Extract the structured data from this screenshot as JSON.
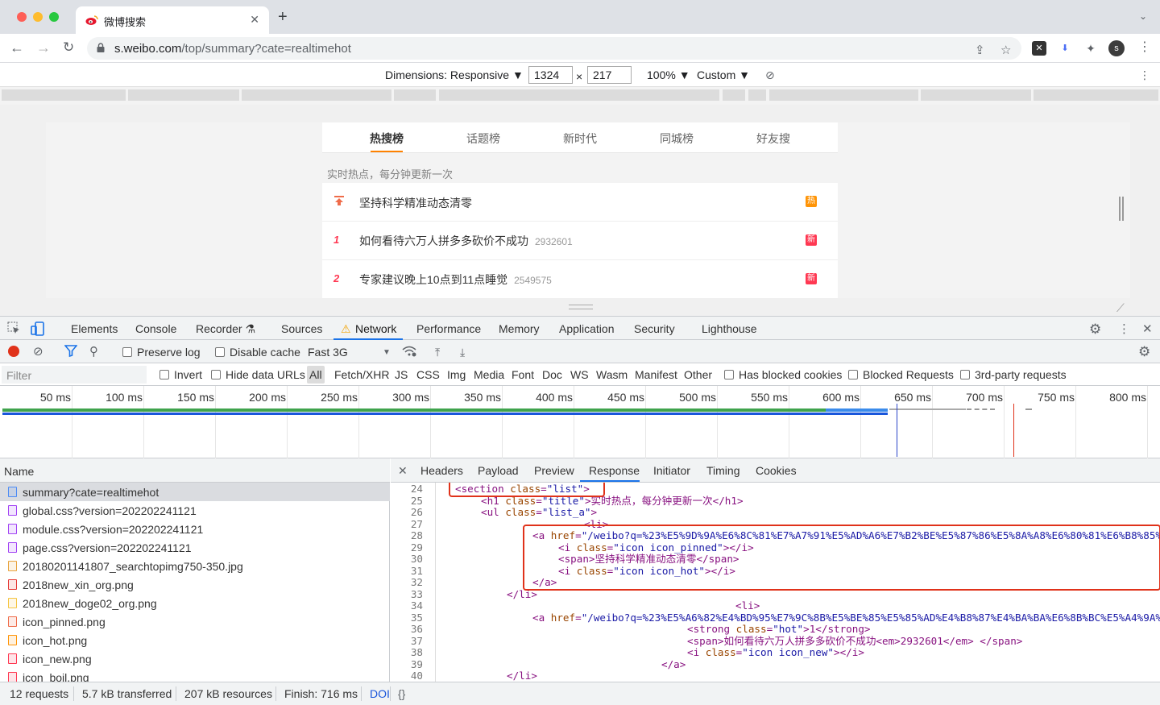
{
  "browser": {
    "tab_title": "微博搜索",
    "url_host": "s.weibo.com",
    "url_path": "/top/summary?cate=realtimehot",
    "avatar_letter": "s"
  },
  "device_toolbar": {
    "dimensions_label": "Dimensions: Responsive ▼",
    "width": "1324",
    "times": "×",
    "height": "217",
    "zoom": "100% ▼",
    "throttle": "Custom ▼"
  },
  "weibo": {
    "tabs": [
      "热搜榜",
      "话题榜",
      "新时代",
      "同城榜",
      "好友搜"
    ],
    "subtitle": "实时热点，每分钟更新一次",
    "rows": [
      {
        "rank": "",
        "text": "坚持科学精准动态清零",
        "count": "",
        "badge": "热",
        "badge_color": "#ff9406"
      },
      {
        "rank": "1",
        "text": "如何看待六万人拼多多砍价不成功",
        "count": "2932601",
        "badge": "新",
        "badge_color": "#ff3852"
      },
      {
        "rank": "2",
        "text": "专家建议晚上10点到11点睡觉",
        "count": "2549575",
        "badge": "新",
        "badge_color": "#ff3852"
      }
    ]
  },
  "devtools": {
    "tabs": [
      "Elements",
      "Console",
      "Recorder ⚗",
      "Sources",
      "Network",
      "Performance",
      "Memory",
      "Application",
      "Security",
      "Lighthouse"
    ],
    "network_bar": {
      "preserve_log": "Preserve log",
      "disable_cache": "Disable cache",
      "throttling": "Fast 3G"
    },
    "filter": {
      "placeholder": "Filter",
      "invert": "Invert",
      "hide_data_urls": "Hide data URLs",
      "types": [
        "All",
        "Fetch/XHR",
        "JS",
        "CSS",
        "Img",
        "Media",
        "Font",
        "Doc",
        "WS",
        "Wasm",
        "Manifest",
        "Other"
      ],
      "has_blocked_cookies": "Has blocked cookies",
      "blocked_requests": "Blocked Requests",
      "third_party": "3rd-party requests"
    },
    "timeline_ticks": [
      "50 ms",
      "100 ms",
      "150 ms",
      "200 ms",
      "250 ms",
      "300 ms",
      "350 ms",
      "400 ms",
      "450 ms",
      "500 ms",
      "550 ms",
      "600 ms",
      "650 ms",
      "700 ms",
      "750 ms",
      "800 ms"
    ],
    "name_header": "Name",
    "requests": [
      {
        "name": "summary?cate=realtimehot",
        "icon_color": "#4c8bf5"
      },
      {
        "name": "global.css?version=202202241121",
        "icon_color": "#a142f4"
      },
      {
        "name": "module.css?version=202202241121",
        "icon_color": "#a142f4"
      },
      {
        "name": "page.css?version=202202241121",
        "icon_color": "#a142f4"
      },
      {
        "name": "20180201141807_searchtopimg750-350.jpg",
        "icon_color": "#e8a33d"
      },
      {
        "name": "2018new_xin_org.png",
        "icon_color": "#e53935"
      },
      {
        "name": "2018new_doge02_org.png",
        "icon_color": "#f5c542"
      },
      {
        "name": "icon_pinned.png",
        "icon_color": "#ef6c4a"
      },
      {
        "name": "icon_hot.png",
        "icon_color": "#ff9406"
      },
      {
        "name": "icon_new.png",
        "icon_color": "#ff3852"
      },
      {
        "name": "icon_boil.png",
        "icon_color": "#ff3852"
      }
    ],
    "response_tabs": [
      "Headers",
      "Payload",
      "Preview",
      "Response",
      "Initiator",
      "Timing",
      "Cookies"
    ],
    "line_numbers": [
      "24",
      "25",
      "26",
      "27",
      "28",
      "29",
      "30",
      "31",
      "32",
      "33",
      "34",
      "35",
      "36",
      "37",
      "38",
      "39",
      "40"
    ],
    "code": [
      {
        "pre": "<section ",
        "attr": "class",
        "val": "\"list\"",
        "post": ">"
      },
      {
        "pre": "<h1 ",
        "attr": "class",
        "val": "\"title\"",
        "post": ">实时热点，每分钟更新一次</h1>"
      },
      {
        "pre": "<ul ",
        "attr": "class",
        "val": "\"list_a\"",
        "post": ">"
      },
      {
        "pre": "<li>",
        "attr": "",
        "val": "",
        "post": ""
      },
      {
        "pre": "<a ",
        "attr": "href",
        "val": "\"/weibo?q=%23%E5%9D%9A%E6%8C%81%E7%A7%91%E5%AD%A6%E7%B2%BE%E5%87%86%E5%8A%A8%E6%80%81%E6%B8%85%E9%9B%B6%23\"",
        "post": ""
      },
      {
        "pre": "<i ",
        "attr": "class",
        "val": "\"icon icon_pinned\"",
        "post": "></i>"
      },
      {
        "pre": "<span>",
        "attr": "",
        "val": "",
        "post": "坚持科学精准动态清零</span>"
      },
      {
        "pre": "<i ",
        "attr": "class",
        "val": "\"icon icon_hot\"",
        "post": "></i>"
      },
      {
        "pre": "</a>",
        "attr": "",
        "val": "",
        "post": ""
      },
      {
        "pre": "</li>",
        "attr": "",
        "val": "",
        "post": ""
      },
      {
        "pre": "<li>",
        "attr": "",
        "val": "",
        "post": ""
      },
      {
        "pre": "<a ",
        "attr": "href",
        "val": "\"/weibo?q=%23%E5%A6%82%E4%BD%95%E7%9C%8B%E5%BE%85%E5%85%AD%E4%B8%87%E4%BA%BA%E6%8B%BC%E5%A4%9A%E5%A4%9A%E7%A0%8D%E4%BB%B7%E4%B8%8D%E6%88%90%E5%8A%9F%23\"",
        "post": ""
      },
      {
        "pre": "<strong ",
        "attr": "class",
        "val": "\"hot\"",
        "post": ">1</strong>"
      },
      {
        "pre": "<span>",
        "attr": "",
        "val": "",
        "post": "如何看待六万人拼多多砍价不成功<em>2932601</em> </span>"
      },
      {
        "pre": "<i ",
        "attr": "class",
        "val": "\"icon icon_new\"",
        "post": "></i>"
      },
      {
        "pre": "</a>",
        "attr": "",
        "val": "",
        "post": ""
      },
      {
        "pre": "</li>",
        "attr": "",
        "val": "",
        "post": ""
      }
    ],
    "status": {
      "requests": "12 requests",
      "transferred": "5.7 kB transferred",
      "resources": "207 kB resources",
      "finish": "Finish: 716 ms",
      "dom": "DOI",
      "format": "{}"
    }
  }
}
